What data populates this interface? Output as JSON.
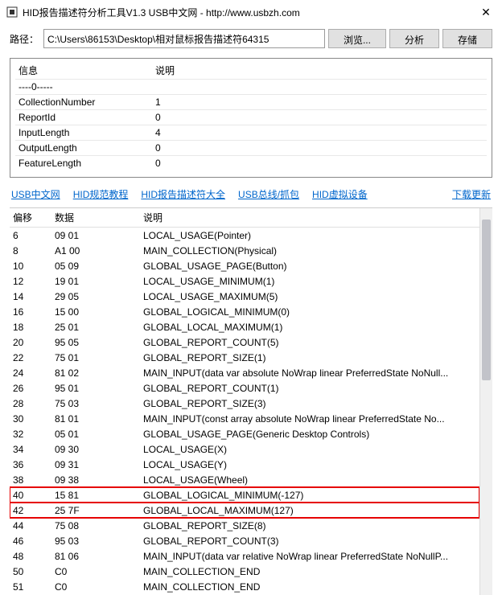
{
  "window": {
    "title": "HID报告描述符分析工具V1.3 USB中文网 - http://www.usbzh.com",
    "close": "✕"
  },
  "path": {
    "label": "路径：",
    "value": "C:\\Users\\86153\\Desktop\\相对鼠标报告描述符64315"
  },
  "buttons": {
    "browse": "浏览...",
    "analyze": "分析",
    "save": "存储"
  },
  "info": {
    "col1": "信息",
    "col2": "说明",
    "rows": [
      {
        "k": "----0-----",
        "v": ""
      },
      {
        "k": "CollectionNumber",
        "v": "1"
      },
      {
        "k": "ReportId",
        "v": "0"
      },
      {
        "k": "InputLength",
        "v": "4"
      },
      {
        "k": "OutputLength",
        "v": "0"
      },
      {
        "k": "FeatureLength",
        "v": "0"
      }
    ]
  },
  "links": {
    "l1": "USB中文网",
    "l2": "HID规范教程",
    "l3": "HID报告描述符大全",
    "l4": "USB总线/抓包",
    "l5": "HID虚拟设备",
    "update": "下载更新"
  },
  "data": {
    "colOffset": "偏移",
    "colData": "数据",
    "colDesc": "说明",
    "rows": [
      {
        "off": "6",
        "dat": "09 01",
        "desc": "LOCAL_USAGE(Pointer)"
      },
      {
        "off": "8",
        "dat": "A1 00",
        "desc": "MAIN_COLLECTION(Physical)"
      },
      {
        "off": "10",
        "dat": "05 09",
        "desc": "GLOBAL_USAGE_PAGE(Button)"
      },
      {
        "off": "12",
        "dat": "19 01",
        "desc": "LOCAL_USAGE_MINIMUM(1)"
      },
      {
        "off": "14",
        "dat": "29 05",
        "desc": "LOCAL_USAGE_MAXIMUM(5)"
      },
      {
        "off": "16",
        "dat": "15 00",
        "desc": "GLOBAL_LOGICAL_MINIMUM(0)"
      },
      {
        "off": "18",
        "dat": "25 01",
        "desc": "GLOBAL_LOCAL_MAXIMUM(1)"
      },
      {
        "off": "20",
        "dat": "95 05",
        "desc": "GLOBAL_REPORT_COUNT(5)"
      },
      {
        "off": "22",
        "dat": "75 01",
        "desc": "GLOBAL_REPORT_SIZE(1)"
      },
      {
        "off": "24",
        "dat": "81 02",
        "desc": "MAIN_INPUT(data var absolute NoWrap linear PreferredState NoNull..."
      },
      {
        "off": "26",
        "dat": "95 01",
        "desc": "GLOBAL_REPORT_COUNT(1)"
      },
      {
        "off": "28",
        "dat": "75 03",
        "desc": "GLOBAL_REPORT_SIZE(3)"
      },
      {
        "off": "30",
        "dat": "81 01",
        "desc": "MAIN_INPUT(const array absolute NoWrap linear PreferredState No..."
      },
      {
        "off": "32",
        "dat": "05 01",
        "desc": "GLOBAL_USAGE_PAGE(Generic Desktop Controls)"
      },
      {
        "off": "34",
        "dat": "09 30",
        "desc": "LOCAL_USAGE(X)"
      },
      {
        "off": "36",
        "dat": "09 31",
        "desc": "LOCAL_USAGE(Y)"
      },
      {
        "off": "38",
        "dat": "09 38",
        "desc": "LOCAL_USAGE(Wheel)"
      },
      {
        "off": "40",
        "dat": "15 81",
        "desc": "GLOBAL_LOGICAL_MINIMUM(-127)",
        "hl": true
      },
      {
        "off": "42",
        "dat": "25 7F",
        "desc": "GLOBAL_LOCAL_MAXIMUM(127)",
        "hl": true
      },
      {
        "off": "44",
        "dat": "75 08",
        "desc": "GLOBAL_REPORT_SIZE(8)"
      },
      {
        "off": "46",
        "dat": "95 03",
        "desc": "GLOBAL_REPORT_COUNT(3)"
      },
      {
        "off": "48",
        "dat": "81 06",
        "desc": "MAIN_INPUT(data var relative NoWrap linear PreferredState NoNullP..."
      },
      {
        "off": "50",
        "dat": "C0",
        "desc": "MAIN_COLLECTION_END"
      },
      {
        "off": "51",
        "dat": "C0",
        "desc": "MAIN_COLLECTION_END"
      }
    ]
  }
}
